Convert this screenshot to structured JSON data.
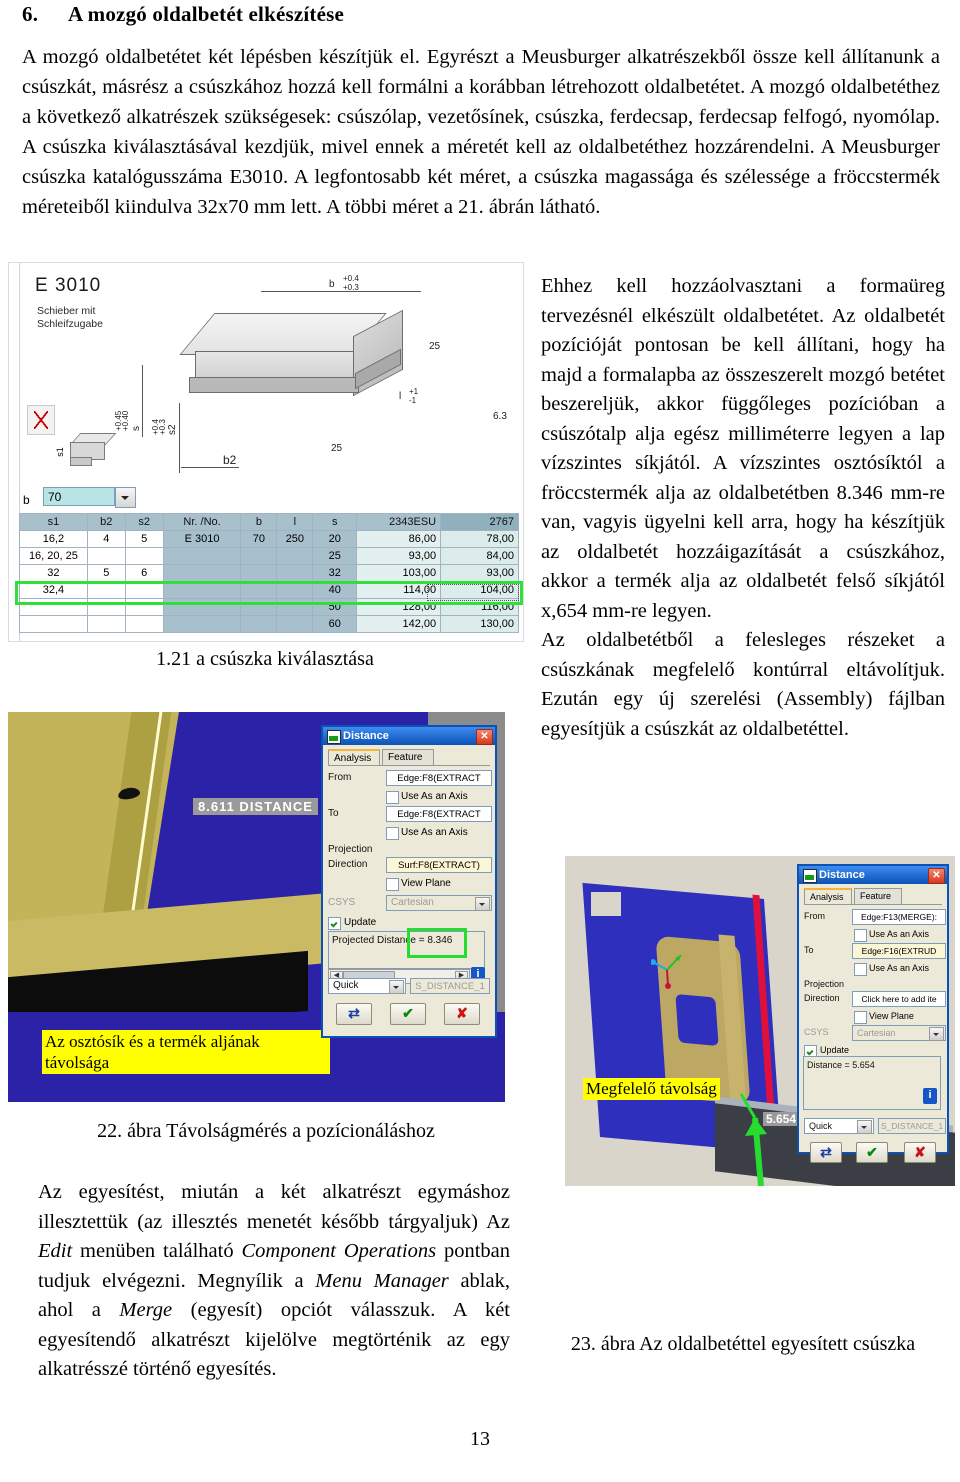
{
  "heading": {
    "number": "6.",
    "title": "A mozgó oldalbetét elkészítése"
  },
  "intro": "A mozgó oldalbetétet két lépésben készítjük el. Egyrészt a Meusburger alkatrészekből össze kell állítanunk a csúszkát, másrész a csúszkához hozzá kell formálni a korábban létrehozott oldalbetétet. A mozgó oldalbetéthez a következő alkatrészek szükségesek: csúszólap, vezetősínek, csúszka, ferdecsap, ferdecsap felfogó, nyomólap. A csúszka kiválasztásával kezdjük, mivel ennek a méretét kell az oldalbetéthez hozzárendelni. A Meusburger csúszka katalógusszáma E3010. A legfontosabb két méret, a csúszka magassága és szélessége a fröccstermék méreteiből kiindulva 32x70 mm lett. A többi méret a 21. ábrán látható.",
  "catalog": {
    "code": "E 3010",
    "subtitle_line1": "Schieber mit",
    "subtitle_line2": "Schleifzugabe",
    "dims": {
      "b_label": "b",
      "b_tol_upper": "+0.4",
      "b_tol_lower": "+0.3",
      "l_label": "l",
      "l_tol_upper": "+1",
      "l_tol_lower": "-1",
      "s_label": "s",
      "s_tol_upper": "+0.45",
      "s_tol_lower": "+0.40",
      "s2_label": "s2",
      "s2_tol_upper": "+0.4",
      "s2_tol_lower": "+0.3",
      "b2_label": "b2",
      "s1_label": "s1",
      "rough_25a": "25",
      "rough_25b": "25",
      "rough_63": "6.3"
    },
    "b_selector": {
      "label": "b",
      "value": "70"
    },
    "table": {
      "headers": [
        "s1",
        "b2",
        "s2",
        "Nr. /No.",
        "b",
        "l",
        "s",
        "2343ESU",
        "2767"
      ],
      "rows": [
        [
          "16,2",
          "4",
          "5",
          "E 3010",
          "70",
          "250",
          "20",
          "86,00",
          "78,00"
        ],
        [
          "16, 20, 25",
          "",
          "",
          "",
          "",
          "",
          "25",
          "93,00",
          "84,00"
        ],
        [
          "32",
          "5",
          "6",
          "",
          "",
          "",
          "32",
          "103,00",
          "93,00"
        ],
        [
          "32,4",
          "",
          "",
          "",
          "",
          "",
          "40",
          "114,00",
          "104,00"
        ],
        [
          "",
          "",
          "",
          "",
          "",
          "",
          "50",
          "128,00",
          "116,00"
        ],
        [
          "",
          "",
          "",
          "",
          "",
          "",
          "60",
          "142,00",
          "130,00"
        ]
      ],
      "highlighted_row_index": 2,
      "selected_cell": "93,00"
    }
  },
  "caption_21": "1.21 a csúszka kiválasztása",
  "figure22": {
    "viewport_label": "8.611  DISTANCE",
    "annotation": "Az osztósík és a termék aljának távolsága",
    "dialog": {
      "title": "Distance",
      "close_label": "✕",
      "tabs": [
        "Analysis",
        "Feature"
      ],
      "active_tab": "Analysis",
      "from_label": "From",
      "from_value": "Edge:F8(EXTRACT",
      "from_axis_label": "Use As an Axis",
      "to_label": "To",
      "to_value": "Edge:F8(EXTRACT",
      "to_axis_label": "Use As an Axis",
      "projection_label_1": "Projection",
      "projection_label_2": "Direction",
      "projection_value": "Surf:F8(EXTRACT)",
      "view_plane_label": "View Plane",
      "csys_label": "CSYS",
      "csys_value": "Cartesian",
      "update_label": "Update",
      "result_text": "Projected Distance = 8.346",
      "mode_value": "Quick",
      "name_value": "S_DISTANCE_1",
      "info_label": "i",
      "btn_flip": "⇄",
      "btn_ok": "✔",
      "btn_cancel": "✘"
    }
  },
  "caption_22": "22. ábra Távolságmérés a pozícionáláshoz",
  "right_text": {
    "p1": "Ehhez kell hozzáolvasztani a formaüreg tervezésnél elkészült oldalbetétet. Az oldalbetét pozícióját pontosan be kell állítani, hogy ha majd a formalapba az összeszerelt mozgó betétet beszereljük, akkor függőleges pozícióban a csúszótalp alja egész milliméterre legyen a lap vízszintes síkjától. A vízszintes osztósíktól a fröccstermék alja az oldalbetétben 8.346 mm-re van, vagyis ügyelni kell arra, hogy ha készítjük az oldalbetét hozzáigazítását a csúszkához, akkor a termék alja az oldalbetét felső síkjától x,654 mm-re legyen.",
    "p2": "Az oldalbetétből a felesleges részeket a csúszkának megfelelő kontúrral eltávolítjuk. Ezután egy új szerelési (Assembly) fájlban egyesítjük a csúszkát az oldalbetéttel."
  },
  "figure23": {
    "viewport_label": "5.654",
    "annotation": "Megfelelő távolság",
    "dialog": {
      "title": "Distance",
      "close_label": "✕",
      "tabs": [
        "Analysis",
        "Feature"
      ],
      "active_tab": "Analysis",
      "from_label": "From",
      "from_value": "Edge:F13(MERGE):",
      "from_axis_label": "Use As an Axis",
      "to_label": "To",
      "to_value": "Edge:F16(EXTRUD",
      "to_axis_label": "Use As an Axis",
      "projection_label_1": "Projection",
      "projection_label_2": "Direction",
      "projection_value": "Click here to add ite",
      "view_plane_label": "View Plane",
      "csys_label": "CSYS",
      "csys_value": "Cartesian",
      "update_label": "Update",
      "result_text": "Distance = 5.654",
      "mode_value": "Quick",
      "name_value": "S_DISTANCE_1",
      "info_label": "i",
      "btn_flip": "⇄",
      "btn_ok": "✔",
      "btn_cancel": "✘"
    }
  },
  "caption_23": "23. ábra Az oldalbetéttel egyesített csúszka",
  "bottom_text": {
    "seg1": "Az egyesítést, miután a két alkatrészt egymáshoz illesztettük (az illesztés menetét később tárgyaljuk) Az ",
    "it1": "Edit",
    "seg2": " menüben található ",
    "it2": "Component Operations",
    "seg3": " pontban tudjuk elvégezni. Megnyílik a ",
    "it3": "Menu Manager",
    "seg4": " ablak, ahol a ",
    "it4": "Merge",
    "seg5": " (egyesít) opciót válasszuk. A két egyesítendő alkatrészt kijelölve megtörténik az egy alkatrésszé történő egyesítés."
  },
  "page_number": "13",
  "colors": {
    "highlight_green": "#25dc2f",
    "annotation_yellow": "#ffff00",
    "dialog_blue": "#0a52b6",
    "table_header": "#a8c0cc"
  }
}
